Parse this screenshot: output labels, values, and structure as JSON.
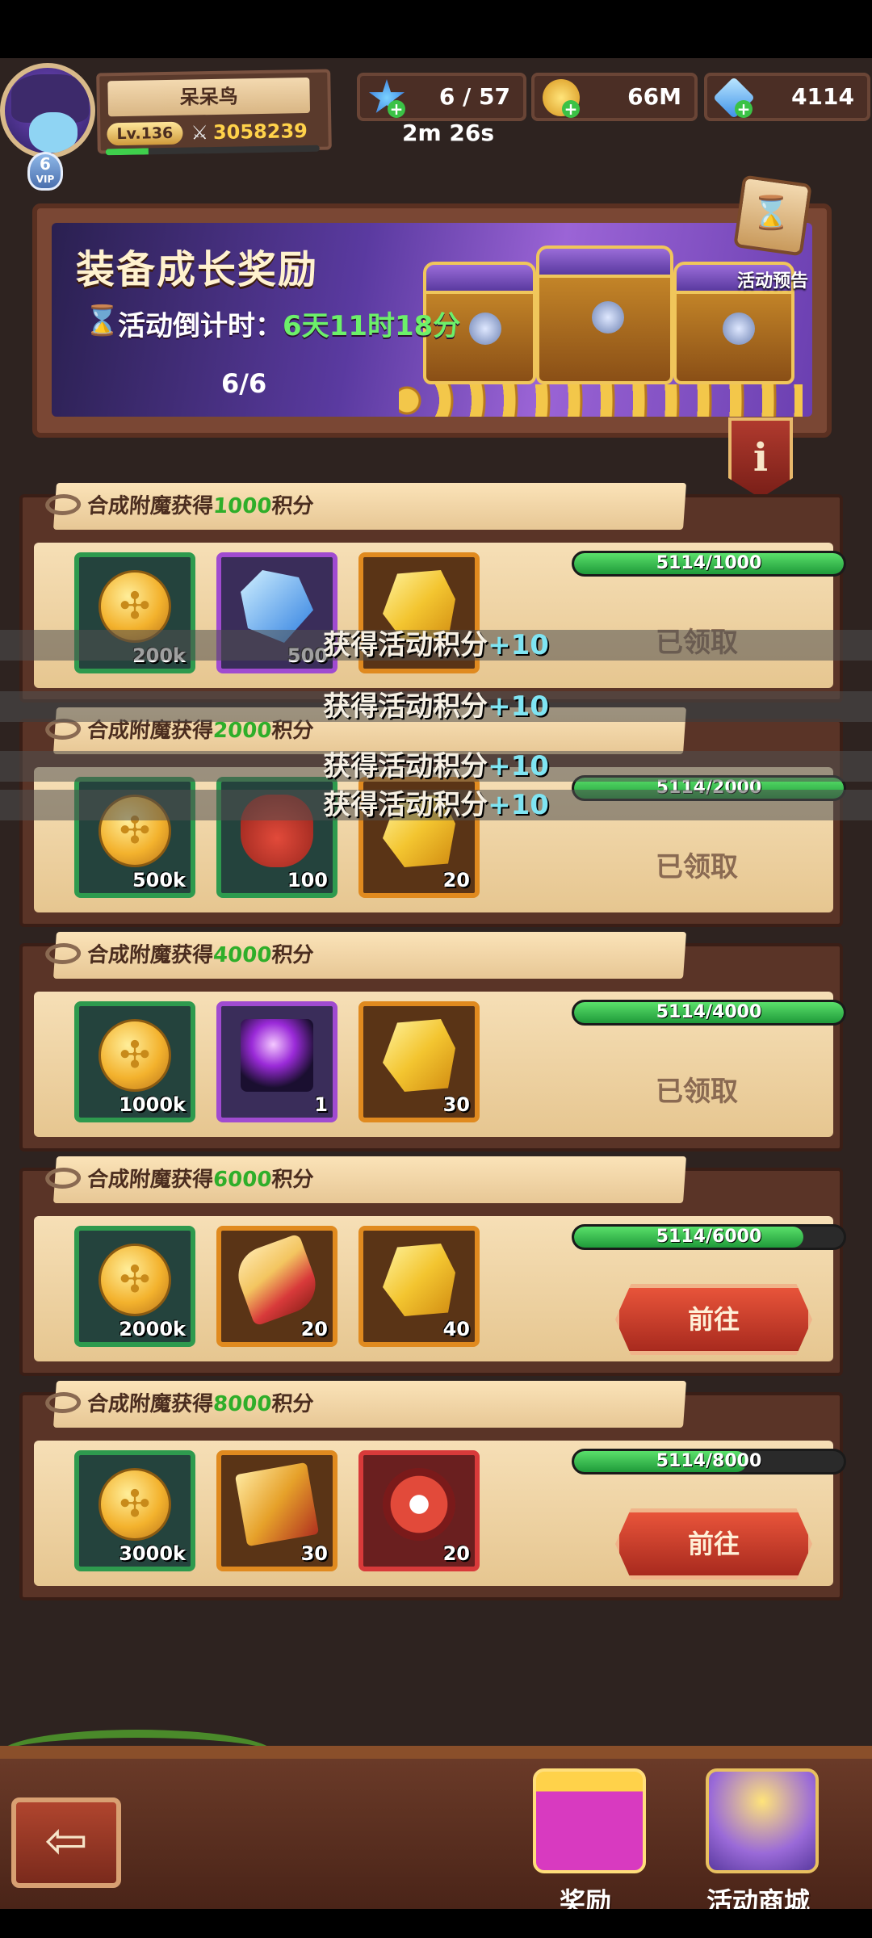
{
  "header": {
    "player_name": "呆呆鸟",
    "level": "Lv.136",
    "power": "3058239",
    "vip_level": "6",
    "vip_label": "VIP",
    "stamina": "6 / 57",
    "stamina_timer": "2m 26s",
    "gold": "66M",
    "gems": "4114"
  },
  "banner": {
    "title": "装备成长奖励",
    "countdown_label": "活动倒计时：",
    "countdown_value": "6天11时18分",
    "progress": "6/6",
    "preview_label": "活动预告",
    "info_label": "i"
  },
  "rows": [
    {
      "title_prefix": "合成附魔获得",
      "points": "1000",
      "title_suffix": "积分",
      "progress_text": "5114/1000",
      "progress_fraction": 1.0,
      "status": "已领取",
      "items": [
        {
          "icon": "gold-coin",
          "count": "200k"
        },
        {
          "icon": "blue-crystal",
          "count": "500"
        },
        {
          "icon": "gold-ore",
          "count": ""
        }
      ]
    },
    {
      "title_prefix": "合成附魔获得",
      "points": "2000",
      "title_suffix": "积分",
      "progress_text": "5114/2000",
      "progress_fraction": 1.0,
      "status": "已领取",
      "items": [
        {
          "icon": "gold-coin",
          "count": "500k"
        },
        {
          "icon": "lucky-bag",
          "count": "100"
        },
        {
          "icon": "gold-ore",
          "count": "20"
        }
      ]
    },
    {
      "title_prefix": "合成附魔获得",
      "points": "4000",
      "title_suffix": "积分",
      "progress_text": "5114/4000",
      "progress_fraction": 1.0,
      "status": "已领取",
      "items": [
        {
          "icon": "gold-coin",
          "count": "1000k"
        },
        {
          "icon": "magic-wand",
          "count": "1"
        },
        {
          "icon": "gold-ore",
          "count": "30"
        }
      ]
    },
    {
      "title_prefix": "合成附魔获得",
      "points": "6000",
      "title_suffix": "积分",
      "progress_text": "5114/6000",
      "progress_fraction": 0.85,
      "status": "前往",
      "items": [
        {
          "icon": "gold-coin",
          "count": "2000k"
        },
        {
          "icon": "rose-scroll",
          "count": "20"
        },
        {
          "icon": "gold-ore",
          "count": "40"
        }
      ]
    },
    {
      "title_prefix": "合成附魔获得",
      "points": "8000",
      "title_suffix": "积分",
      "progress_text": "5114/8000",
      "progress_fraction": 0.64,
      "status": "前往",
      "items": [
        {
          "icon": "gold-coin",
          "count": "3000k"
        },
        {
          "icon": "golden-book",
          "count": "30"
        },
        {
          "icon": "paw-badge",
          "count": "20"
        }
      ]
    }
  ],
  "toasts": [
    {
      "text": "获得活动积分",
      "plus": "+10"
    },
    {
      "text": "获得活动积分",
      "plus": "+10"
    },
    {
      "text": "获得活动积分",
      "plus": "+10"
    },
    {
      "text": "获得活动积分",
      "plus": "+10"
    }
  ],
  "bottom_nav": {
    "back_glyph": "⇦",
    "reward_label": "奖励",
    "shop_label": "活动商城"
  },
  "colors": {
    "claimed_text": "#8a6a52",
    "points_green": "#2fae2a",
    "progress_green": "#3fcf4c",
    "go_button_red": "#c63a28"
  }
}
